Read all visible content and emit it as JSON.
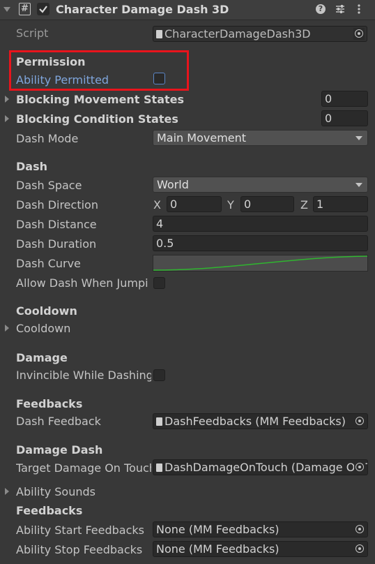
{
  "header": {
    "title": "Character Damage Dash 3D",
    "enabled": true
  },
  "script": {
    "label": "Script",
    "value": "CharacterDamageDash3D"
  },
  "permission": {
    "heading": "Permission",
    "ability_permitted_label": "Ability Permitted",
    "ability_permitted": false,
    "highlight_color": "#e8141c"
  },
  "blocking_movement": {
    "label": "Blocking Movement States",
    "value": "0"
  },
  "blocking_condition": {
    "label": "Blocking Condition States",
    "value": "0"
  },
  "dash_mode": {
    "label": "Dash Mode",
    "value": "Main Movement"
  },
  "dash": {
    "heading": "Dash",
    "space_label": "Dash Space",
    "space_value": "World",
    "direction_label": "Dash Direction",
    "x_label": "X",
    "x": "0",
    "y_label": "Y",
    "y": "0",
    "z_label": "Z",
    "z": "1",
    "distance_label": "Dash Distance",
    "distance": "4",
    "duration_label": "Dash Duration",
    "duration": "0.5",
    "curve_label": "Dash Curve",
    "curve_color": "#2fb52f",
    "allow_label": "Allow Dash When Jumpi",
    "allow": false
  },
  "cooldown": {
    "heading": "Cooldown",
    "foldout_label": "Cooldown"
  },
  "damage": {
    "heading": "Damage",
    "invincible_label": "Invincible While Dashing",
    "invincible": false
  },
  "feedbacks": {
    "heading": "Feedbacks",
    "dash_feedback_label": "Dash Feedback",
    "dash_feedback_value": "DashFeedbacks (MM Feedbacks)"
  },
  "damage_dash": {
    "heading": "Damage Dash",
    "target_label": "Target Damage On Touch",
    "target_value": "DashDamageOnTouch (Damage On Touch)"
  },
  "ability_sounds": {
    "label": "Ability Sounds"
  },
  "ability_feedbacks": {
    "heading": "Feedbacks",
    "start_label": "Ability Start Feedbacks",
    "start_value": "None (MM Feedbacks)",
    "stop_label": "Ability Stop Feedbacks",
    "stop_value": "None (MM Feedbacks)"
  },
  "icons": [
    "foldout-arrow-icon",
    "script-hash-icon",
    "checkbox-icon",
    "help-icon",
    "presets-icon",
    "more-icon",
    "target-icon",
    "file-icon"
  ]
}
